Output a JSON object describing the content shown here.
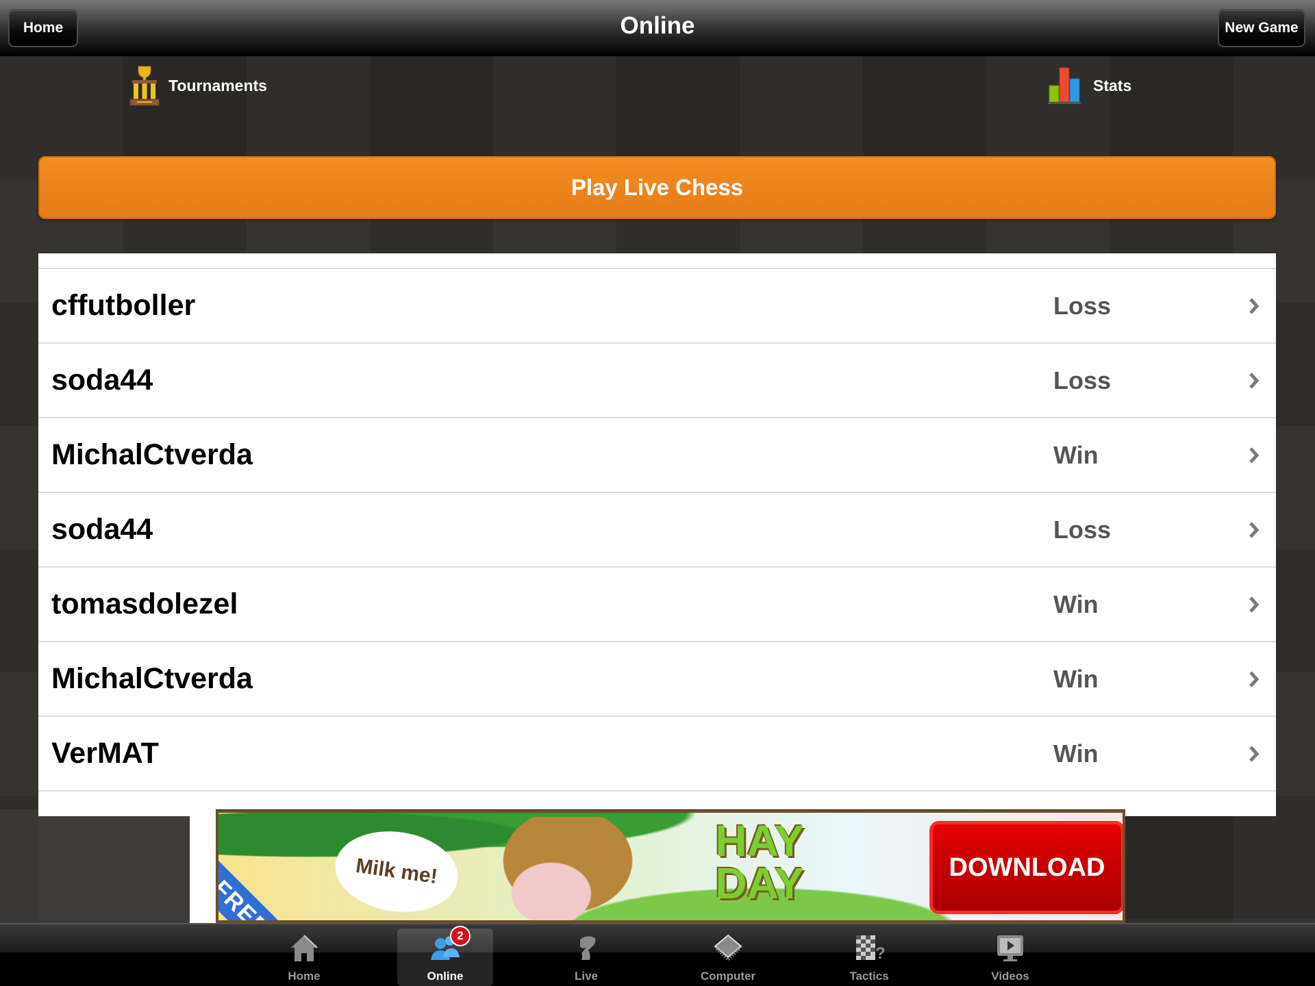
{
  "navbar": {
    "title": "Online",
    "home_label": "Home",
    "new_game_label": "New Game"
  },
  "quick_links": {
    "tournaments": {
      "label": "Tournaments",
      "icon": "trophy-icon"
    },
    "stats": {
      "label": "Stats",
      "icon": "bar-chart-icon"
    }
  },
  "play_button": {
    "label": "Play Live Chess",
    "color": "#f48d22"
  },
  "games": [
    {
      "opponent": "cffutboller",
      "result": "Loss"
    },
    {
      "opponent": "soda44",
      "result": "Loss"
    },
    {
      "opponent": "MichalCtverda",
      "result": "Win"
    },
    {
      "opponent": "soda44",
      "result": "Loss"
    },
    {
      "opponent": "tomasdolezel",
      "result": "Win"
    },
    {
      "opponent": "MichalCtverda",
      "result": "Win"
    },
    {
      "opponent": "VerMAT",
      "result": "Win"
    }
  ],
  "ad": {
    "ribbon": "FREE",
    "bubble": "Milk me!",
    "logo": "HAY DAY",
    "cta": "DOWNLOAD"
  },
  "tabbar": {
    "active": "Online",
    "tabs": [
      {
        "label": "Home",
        "icon": "house-icon"
      },
      {
        "label": "Online",
        "icon": "users-icon",
        "badge": "2"
      },
      {
        "label": "Live",
        "icon": "knight-icon"
      },
      {
        "label": "Computer",
        "icon": "chip-icon"
      },
      {
        "label": "Tactics",
        "icon": "chessboard-question-icon"
      },
      {
        "label": "Videos",
        "icon": "monitor-play-icon"
      }
    ]
  }
}
